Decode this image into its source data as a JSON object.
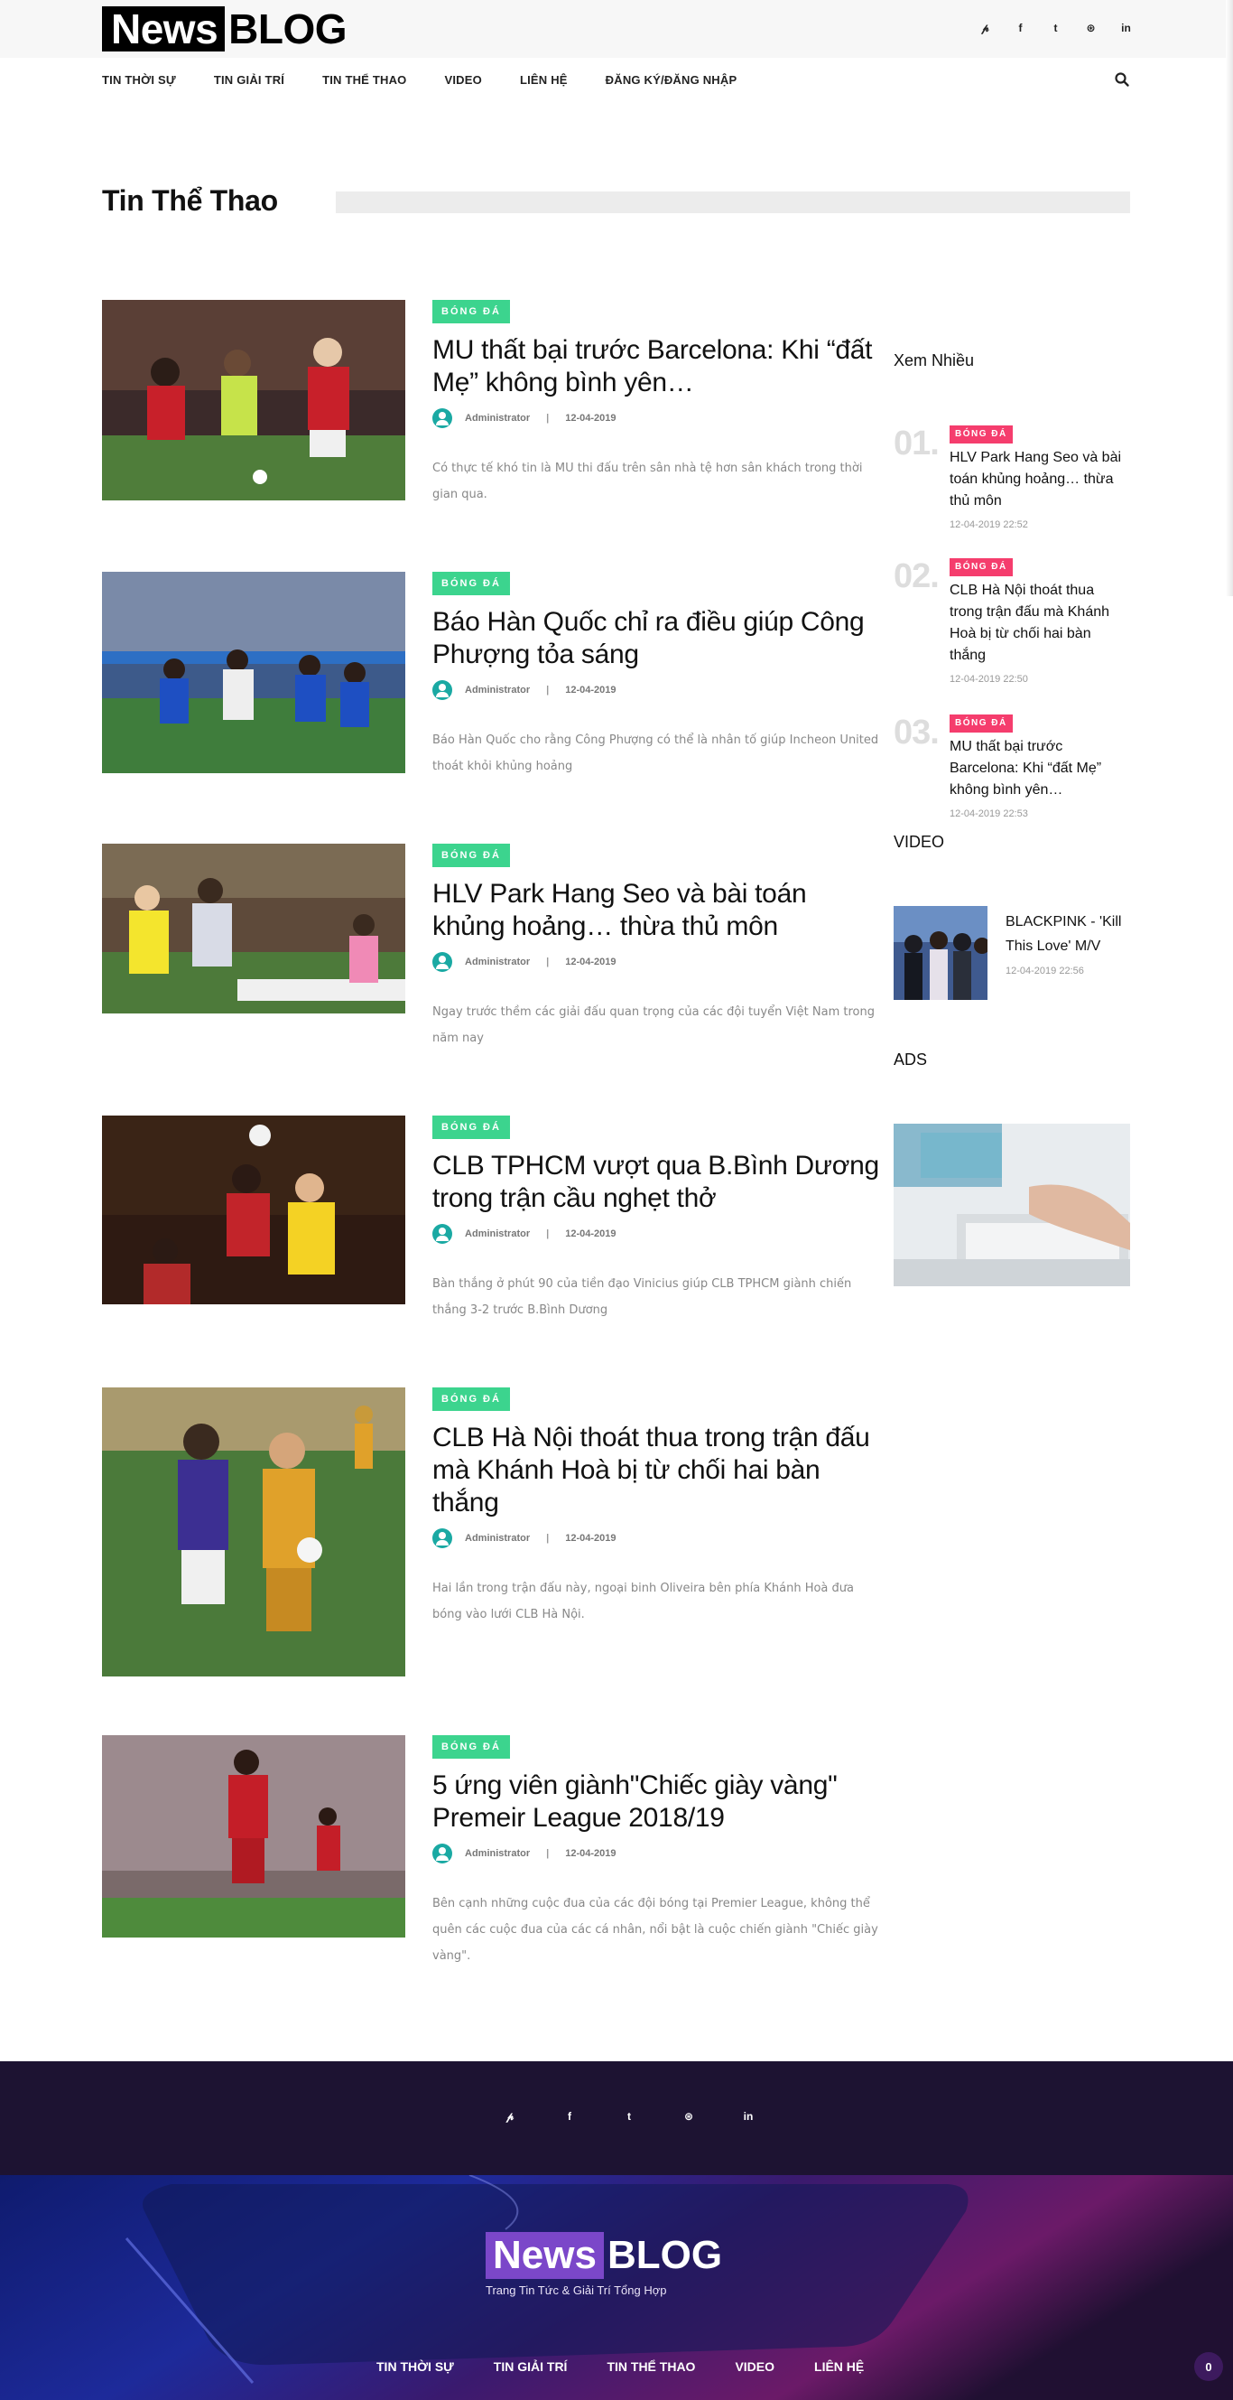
{
  "logo": {
    "news": "News",
    "blog": "BLOG"
  },
  "social": [
    "𝓅",
    "f",
    "t",
    "⊛",
    "in"
  ],
  "nav": [
    "TIN THỜI SỰ",
    "TIN GIẢI TRÍ",
    "TIN THỂ THAO",
    "VIDEO",
    "LIÊN HỆ",
    "ĐĂNG KÝ/ĐĂNG NHẬP"
  ],
  "section_title": "Tin Thể Thao",
  "articles": [
    {
      "tag": "BÓNG ĐÁ",
      "title": "MU thất bại trước Barcelona: Khi “đất Mẹ” không bình yên…",
      "author": "Administrator",
      "date": "12-04-2019",
      "desc": "Có thực tế khó tin là MU thi đấu trên sân nhà tệ hơn sân khách trong thời gian qua."
    },
    {
      "tag": "BÓNG ĐÁ",
      "title": "Báo Hàn Quốc chỉ ra điều giúp Công Phượng tỏa sáng",
      "author": "Administrator",
      "date": "12-04-2019",
      "desc": "Báo Hàn Quốc cho rằng Công Phượng có thể là nhân tố giúp Incheon United thoát khỏi khủng hoảng"
    },
    {
      "tag": "BÓNG ĐÁ",
      "title": "HLV Park Hang Seo và bài toán khủng hoảng… thừa thủ môn",
      "author": "Administrator",
      "date": "12-04-2019",
      "desc": "Ngay trước thềm các giải đấu quan trọng của các đội tuyển Việt Nam trong năm nay"
    },
    {
      "tag": "BÓNG ĐÁ",
      "title": "CLB TPHCM vượt qua B.Bình Dương trong trận cầu nghẹt thở",
      "author": "Administrator",
      "date": "12-04-2019",
      "desc": "Bàn thắng ở phút 90 của tiền đạo Vinicius giúp CLB TPHCM giành chiến thắng 3-2 trước B.Bình Dương"
    },
    {
      "tag": "BÓNG ĐÁ",
      "title": "CLB Hà Nội thoát thua trong trận đấu mà Khánh Hoà bị từ chối hai bàn thắng",
      "author": "Administrator",
      "date": "12-04-2019",
      "desc": "Hai lần trong trận đấu này, ngoại binh Oliveira bên phía Khánh Hoà đưa bóng vào lưới CLB Hà Nội."
    },
    {
      "tag": "BÓNG ĐÁ",
      "title": "5 ứng viên giành\"Chiếc giày vàng\" Premeir League 2018/19",
      "author": "Administrator",
      "date": "12-04-2019",
      "desc": "Bên cạnh những cuộc đua của các đội bóng tại Premier League, không thể quên các cuộc đua của các cá nhân, nổi bật là cuộc chiến giành \"Chiếc giày vàng\"."
    }
  ],
  "sidebar": {
    "popular_title": "Xem Nhiều",
    "popular": [
      {
        "num": "01.",
        "tag": "BÓNG ĐÁ",
        "title": "HLV Park Hang Seo và bài toán khủng hoảng… thừa thủ môn",
        "date": "12-04-2019 22:52"
      },
      {
        "num": "02.",
        "tag": "BÓNG ĐÁ",
        "title": "CLB Hà Nội thoát thua trong trận đấu mà Khánh Hoà bị từ chối hai bàn thắng",
        "date": "12-04-2019 22:50"
      },
      {
        "num": "03.",
        "tag": "BÓNG ĐÁ",
        "title": "MU thất bại trước Barcelona: Khi “đất Mẹ” không bình yên…",
        "date": "12-04-2019 22:53"
      }
    ],
    "video_title": "VIDEO",
    "video": {
      "title": "BLACKPINK - 'Kill This Love' M/V",
      "date": "12-04-2019 22:56"
    },
    "ads_title": "ADS"
  },
  "footer": {
    "news": "News",
    "blog": "BLOG",
    "tagline": "Trang Tin Tức & Giải Trí Tổng Hợp",
    "nav": [
      "TIN THỜI SỰ",
      "TIN GIẢI TRÍ",
      "TIN THỂ THAO",
      "VIDEO",
      "LIÊN HỆ"
    ],
    "cart_count": "0"
  },
  "colors": {
    "tag_green": "#3cd48e",
    "tag_pink": "#f53d6d",
    "footer_dark": "#1d1332",
    "avatar_teal": "#1aa9a3"
  }
}
